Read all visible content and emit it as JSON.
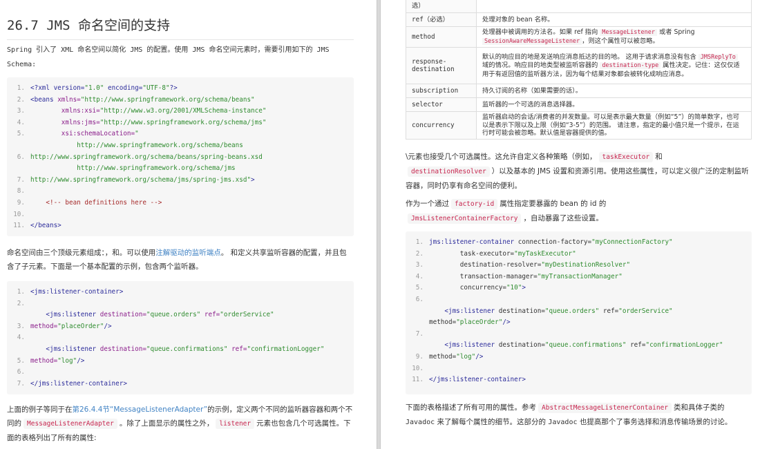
{
  "left": {
    "title": "26.7 JMS 命名空间的支持",
    "intro": [
      {
        "t": "Spring 引入了 XML 命名空间以简化 JMS 的配置。使用 JMS 命名空间元素时，需要引用如下的 JMS Schema:",
        "k": "m"
      }
    ],
    "code1": [
      {
        "n": "1.",
        "s": [
          [
            "<?xml version=",
            "tag"
          ],
          [
            "\"1.0\"",
            "str"
          ],
          [
            " encoding=",
            "tag"
          ],
          [
            "\"UTF-8\"",
            "str"
          ],
          [
            "?>",
            "tag"
          ]
        ]
      },
      {
        "n": "2.",
        "s": [
          [
            "<beans ",
            "tag"
          ],
          [
            "xmlns=",
            "attr"
          ],
          [
            "\"http://www.springframework.org/schema/beans\"",
            "str"
          ]
        ]
      },
      {
        "n": "3.",
        "s": [
          [
            "        xmlns:xsi=",
            "attr"
          ],
          [
            "\"http://www.w3.org/2001/XMLSchema-instance\"",
            "str"
          ]
        ]
      },
      {
        "n": "4.",
        "s": [
          [
            "        xmlns:jms=",
            "attr"
          ],
          [
            "\"http://www.springframework.org/schema/jms\"",
            "str"
          ]
        ]
      },
      {
        "n": "5.",
        "s": [
          [
            "        xsi:schemaLocation=",
            "attr"
          ],
          [
            "\"",
            "str"
          ]
        ]
      },
      {
        "n": "",
        "s": [
          [
            "            http://www.springframework.org/schema/beans",
            "str"
          ]
        ]
      },
      {
        "n": "6.",
        "s": [
          [
            "http://www.springframework.org/schema/beans/spring-beans.xsd",
            "str"
          ]
        ]
      },
      {
        "n": "",
        "s": [
          [
            "            http://www.springframework.org/schema/jms",
            "str"
          ]
        ]
      },
      {
        "n": "7.",
        "s": [
          [
            "http://www.springframework.org/schema/jms/spring-jms.xsd\"",
            "str"
          ],
          [
            ">",
            "tag"
          ]
        ]
      },
      {
        "n": "8.",
        "s": []
      },
      {
        "n": "9.",
        "s": [
          [
            "    <!-- bean definitions here -->",
            "com"
          ]
        ]
      },
      {
        "n": "10.",
        "s": []
      },
      {
        "n": "11.",
        "s": [
          [
            "</beans>",
            "tag"
          ]
        ]
      }
    ],
    "para2": [
      {
        "t": "命名空间由三个顶级元素组成：，和。可以使用",
        "k": "t"
      },
      {
        "t": "注解驱动的监听端点",
        "k": "l"
      },
      {
        "t": "。 和定义共享监听容器的配置，并且包含了子元素。下面是一个基本配置的示例，包含两个监听器。",
        "k": "t"
      }
    ],
    "code2": [
      {
        "n": "1.",
        "s": [
          [
            "<jms:listener-container>",
            "tag"
          ]
        ]
      },
      {
        "n": "2.",
        "s": []
      },
      {
        "n": "",
        "s": [
          [
            "    <jms:listener ",
            "tag"
          ],
          [
            "destination=",
            "attr"
          ],
          [
            "\"queue.orders\"",
            "str"
          ],
          [
            " ref=",
            "attr"
          ],
          [
            "\"orderService\"",
            "str"
          ]
        ]
      },
      {
        "n": "3.",
        "s": [
          [
            "method=",
            "attr"
          ],
          [
            "\"placeOrder\"",
            "str"
          ],
          [
            "/>",
            "tag"
          ]
        ]
      },
      {
        "n": "4.",
        "s": []
      },
      {
        "n": "",
        "s": [
          [
            "    <jms:listener ",
            "tag"
          ],
          [
            "destination=",
            "attr"
          ],
          [
            "\"queue.confirmations\"",
            "str"
          ],
          [
            " ref=",
            "attr"
          ],
          [
            "\"confirmationLogger\"",
            "str"
          ]
        ]
      },
      {
        "n": "5.",
        "s": [
          [
            "method=",
            "attr"
          ],
          [
            "\"log\"",
            "str"
          ],
          [
            "/>",
            "tag"
          ]
        ]
      },
      {
        "n": "6.",
        "s": []
      },
      {
        "n": "7.",
        "s": [
          [
            "</jms:listener-container>",
            "tag"
          ]
        ]
      }
    ],
    "para3": [
      {
        "t": "上面的例子等同于在",
        "k": "t"
      },
      {
        "t": "第26.4.4节“MessageListenerAdapter”",
        "k": "l"
      },
      {
        "t": "的示例，定义两个不同的监听器容器和两个不同的",
        "k": "t"
      },
      {
        "t": "MessageListenerAdapter",
        "k": "c"
      },
      {
        "t": "。除了上面显示的属性之外，",
        "k": "t"
      },
      {
        "t": "listener",
        "k": "c"
      },
      {
        "t": "元素也包含几个可选属性。下面的表格列出了所有的属性:",
        "k": "t"
      }
    ]
  },
  "right": {
    "table": [
      {
        "k": "选）",
        "v": []
      },
      {
        "k": "ref（必选）",
        "v": [
          {
            "t": "处理对象的 bean 名称。",
            "k": "t"
          }
        ]
      },
      {
        "k": "method",
        "v": [
          {
            "t": "处理器中被调用的方法名。如果 ref 指向 ",
            "k": "t"
          },
          {
            "t": "MessageListener",
            "k": "c"
          },
          {
            "t": " 或者 Spring ",
            "k": "t"
          },
          {
            "t": "SessionAwareMessageListener",
            "k": "c"
          },
          {
            "t": "，则这个属性可以被忽略。",
            "k": "t"
          }
        ]
      },
      {
        "k": "response-destination",
        "v": [
          {
            "t": "默认的响应目的地是发送响应消息抵达的目的地。 这用于请求消息没有包含 ",
            "k": "t"
          },
          {
            "t": "JMSReplyTo",
            "k": "c"
          },
          {
            "t": " 域的情况。响应目的地类型被监听容器的 ",
            "k": "t"
          },
          {
            "t": "destination-type",
            "k": "c"
          },
          {
            "t": " 属性决定。记住：这仅仅适用于有返回值的监听器方法，因为每个结果对象都会被转化成响应消息。",
            "k": "t"
          }
        ]
      },
      {
        "k": "subscription",
        "v": [
          {
            "t": "持久订阅的名称（如果需要的话）。",
            "k": "t"
          }
        ]
      },
      {
        "k": "selector",
        "v": [
          {
            "t": "监听器的一个可选的消息选择器。",
            "k": "t"
          }
        ]
      },
      {
        "k": "concurrency",
        "v": [
          {
            "t": "监听器启动的会话/消费者的并发数量。可以是表示最大数量（例如“5”）的简单数字，也可以是表示下限以及上限（例如“3-5”）的范围。 请注意，指定的最小值只是一个提示，在运行时可能会被忽略。默认值是容器提供的值。",
            "k": "t"
          }
        ]
      }
    ],
    "para1": [
      {
        "t": "\\元素也接受几个可选属性。这允许自定义各种策略（例如，",
        "k": "t"
      },
      {
        "t": "taskExecutor",
        "k": "c"
      },
      {
        "t": "和",
        "k": "t"
      },
      {
        "t": "destinationResolver",
        "k": "c"
      },
      {
        "t": "）以及基本的 JMS 设置和资源引用。使用这些属性，可以定义很广泛的定制监听容器，同时仍享有命名空间的便利。",
        "k": "t"
      }
    ],
    "para2": [
      {
        "t": "作为一个通过",
        "k": "t"
      },
      {
        "t": "factory-id",
        "k": "c"
      },
      {
        "t": "属性指定要暴露的 bean 的 id 的",
        "k": "t"
      },
      {
        "t": "JmsListenerContainerFactory",
        "k": "c"
      },
      {
        "t": "，自动暴露了这些设置。",
        "k": "t"
      }
    ],
    "code": [
      {
        "n": "1.",
        "s": [
          [
            "jms:listener-container ",
            "tag"
          ],
          [
            "connection-factory=",
            "pl"
          ],
          [
            "\"myConnectionFactory\"",
            "str"
          ]
        ]
      },
      {
        "n": "2.",
        "s": [
          [
            "        task-executor=",
            "pl"
          ],
          [
            "\"myTaskExecutor\"",
            "str"
          ]
        ]
      },
      {
        "n": "3.",
        "s": [
          [
            "        destination-resolver=",
            "pl"
          ],
          [
            "\"myDestinationResolver\"",
            "str"
          ]
        ]
      },
      {
        "n": "4.",
        "s": [
          [
            "        transaction-manager=",
            "pl"
          ],
          [
            "\"myTransactionManager\"",
            "str"
          ]
        ]
      },
      {
        "n": "5.",
        "s": [
          [
            "        concurrency=",
            "pl"
          ],
          [
            "\"10\"",
            "str"
          ],
          [
            ">",
            "tag"
          ]
        ]
      },
      {
        "n": "6.",
        "s": []
      },
      {
        "n": "",
        "s": [
          [
            "    <jms:listener ",
            "tag"
          ],
          [
            "destination=",
            "pl"
          ],
          [
            "\"queue.orders\"",
            "str"
          ],
          [
            " ref=",
            "pl"
          ],
          [
            "\"orderService\"",
            "str"
          ]
        ]
      },
      {
        "n": "",
        "s": [
          [
            "method=",
            "pl"
          ],
          [
            "\"placeOrder\"",
            "str"
          ],
          [
            "/>",
            "tag"
          ]
        ]
      },
      {
        "n": "7.",
        "s": []
      },
      {
        "n": "",
        "s": [
          [
            "    <jms:listener ",
            "tag"
          ],
          [
            "destination=",
            "pl"
          ],
          [
            "\"queue.confirmations\"",
            "str"
          ],
          [
            " ref=",
            "pl"
          ],
          [
            "\"confirmationLogger\"",
            "str"
          ]
        ]
      },
      {
        "n": "9.",
        "s": [
          [
            "method=",
            "pl"
          ],
          [
            "\"log\"",
            "str"
          ],
          [
            "/>",
            "tag"
          ]
        ]
      },
      {
        "n": "10.",
        "s": []
      },
      {
        "n": "11.",
        "s": [
          [
            "</jms:listener-container>",
            "tag"
          ]
        ]
      }
    ],
    "para3": [
      {
        "t": "下面的表格描述了所有可用的属性。参考",
        "k": "t"
      },
      {
        "t": "AbstractMessageListenerContainer",
        "k": "c"
      },
      {
        "t": "类和具体子类的 ",
        "k": "t"
      },
      {
        "t": "Javadoc",
        "k": "m"
      },
      {
        "t": " 来了解每个属性的细节。这部分的 ",
        "k": "t"
      },
      {
        "t": "Javadoc",
        "k": "m"
      },
      {
        "t": " 也提高那个了事务选择和消息传输场景的讨论。",
        "k": "t"
      }
    ]
  }
}
